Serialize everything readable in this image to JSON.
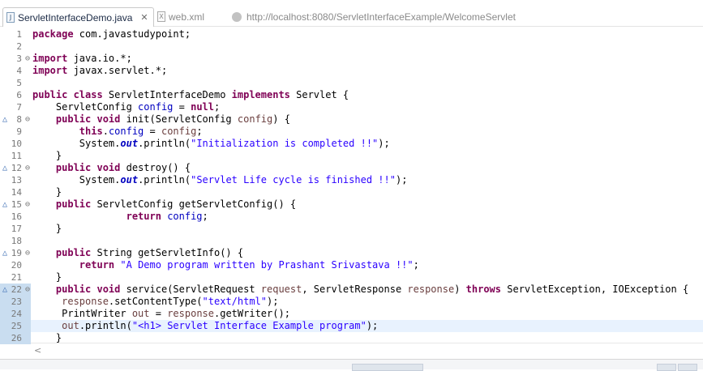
{
  "tabs": [
    {
      "label": "ServletInterfaceDemo.java",
      "icon": "java-file-icon",
      "close": "✕"
    },
    {
      "label": "web.xml",
      "icon": "xml-file-icon"
    },
    {
      "label": "http://localhost:8080/ServletInterfaceExample/WelcomeServlet",
      "icon": "globe-icon"
    }
  ],
  "colors": {
    "keyword": "#7f0055",
    "string": "#2a00ff",
    "field": "#0000c0",
    "parameter": "#6a3e3e",
    "current_line": "#e8f2fe",
    "line_number": "#787878"
  },
  "editor": {
    "current_line": 25,
    "lines": [
      {
        "n": "1",
        "tokens": [
          {
            "t": "kw",
            "v": "package"
          },
          {
            "t": "p",
            "v": " com.javastudypoint;"
          }
        ]
      },
      {
        "n": "2",
        "tokens": []
      },
      {
        "n": "3",
        "fold": "⊖",
        "tokens": [
          {
            "t": "kw",
            "v": "import"
          },
          {
            "t": "p",
            "v": " java.io.*;"
          }
        ]
      },
      {
        "n": "4",
        "tokens": [
          {
            "t": "kw",
            "v": "import"
          },
          {
            "t": "p",
            "v": " javax.servlet.*;"
          }
        ]
      },
      {
        "n": "5",
        "tokens": []
      },
      {
        "n": "6",
        "tokens": [
          {
            "t": "kw",
            "v": "public class"
          },
          {
            "t": "p",
            "v": " ServletInterfaceDemo "
          },
          {
            "t": "kw",
            "v": "implements"
          },
          {
            "t": "p",
            "v": " Servlet {"
          }
        ]
      },
      {
        "n": "7",
        "tokens": [
          {
            "t": "p",
            "v": "    ServletConfig "
          },
          {
            "t": "fld",
            "v": "config"
          },
          {
            "t": "p",
            "v": " = "
          },
          {
            "t": "kw",
            "v": "null"
          },
          {
            "t": "p",
            "v": ";"
          }
        ]
      },
      {
        "n": "8",
        "fold": "⊖",
        "override": "△",
        "tokens": [
          {
            "t": "p",
            "v": "    "
          },
          {
            "t": "kw",
            "v": "public void"
          },
          {
            "t": "p",
            "v": " init(ServletConfig "
          },
          {
            "t": "prm",
            "v": "config"
          },
          {
            "t": "p",
            "v": ") {"
          }
        ]
      },
      {
        "n": "9",
        "tokens": [
          {
            "t": "p",
            "v": "        "
          },
          {
            "t": "kw",
            "v": "this"
          },
          {
            "t": "p",
            "v": "."
          },
          {
            "t": "fld",
            "v": "config"
          },
          {
            "t": "p",
            "v": " = "
          },
          {
            "t": "prm",
            "v": "config"
          },
          {
            "t": "p",
            "v": ";"
          }
        ]
      },
      {
        "n": "10",
        "tokens": [
          {
            "t": "p",
            "v": "        System."
          },
          {
            "t": "sfld",
            "v": "out"
          },
          {
            "t": "p",
            "v": ".println("
          },
          {
            "t": "str",
            "v": "\"Initialization is completed !!\""
          },
          {
            "t": "p",
            "v": ");"
          }
        ]
      },
      {
        "n": "11",
        "tokens": [
          {
            "t": "p",
            "v": "    }"
          }
        ]
      },
      {
        "n": "12",
        "fold": "⊖",
        "override": "△",
        "tokens": [
          {
            "t": "p",
            "v": "    "
          },
          {
            "t": "kw",
            "v": "public void"
          },
          {
            "t": "p",
            "v": " destroy() {"
          }
        ]
      },
      {
        "n": "13",
        "tokens": [
          {
            "t": "p",
            "v": "        System."
          },
          {
            "t": "sfld",
            "v": "out"
          },
          {
            "t": "p",
            "v": ".println("
          },
          {
            "t": "str",
            "v": "\"Servlet Life cycle is finished !!\""
          },
          {
            "t": "p",
            "v": ");"
          }
        ]
      },
      {
        "n": "14",
        "tokens": [
          {
            "t": "p",
            "v": "    }"
          }
        ]
      },
      {
        "n": "15",
        "fold": "⊖",
        "override": "△",
        "tokens": [
          {
            "t": "p",
            "v": "    "
          },
          {
            "t": "kw",
            "v": "public"
          },
          {
            "t": "p",
            "v": " ServletConfig getServletConfig() {"
          }
        ]
      },
      {
        "n": "16",
        "tokens": [
          {
            "t": "p",
            "v": "                "
          },
          {
            "t": "kw",
            "v": "return"
          },
          {
            "t": "p",
            "v": " "
          },
          {
            "t": "fld",
            "v": "config"
          },
          {
            "t": "p",
            "v": ";"
          }
        ]
      },
      {
        "n": "17",
        "tokens": [
          {
            "t": "p",
            "v": "    }"
          }
        ]
      },
      {
        "n": "18",
        "tokens": []
      },
      {
        "n": "19",
        "fold": "⊖",
        "override": "△",
        "tokens": [
          {
            "t": "p",
            "v": "    "
          },
          {
            "t": "kw",
            "v": "public"
          },
          {
            "t": "p",
            "v": " String getServletInfo() {"
          }
        ]
      },
      {
        "n": "20",
        "tokens": [
          {
            "t": "p",
            "v": "        "
          },
          {
            "t": "kw",
            "v": "return"
          },
          {
            "t": "p",
            "v": " "
          },
          {
            "t": "str",
            "v": "\"A Demo program written by Prashant Srivastava !!\""
          },
          {
            "t": "p",
            "v": ";"
          }
        ]
      },
      {
        "n": "21",
        "tokens": [
          {
            "t": "p",
            "v": "    }"
          }
        ]
      },
      {
        "n": "22",
        "fold": "⊖",
        "override": "△",
        "stripe": true,
        "tokens": [
          {
            "t": "p",
            "v": "    "
          },
          {
            "t": "kw",
            "v": "public void"
          },
          {
            "t": "p",
            "v": " service(ServletRequest "
          },
          {
            "t": "prm",
            "v": "request"
          },
          {
            "t": "p",
            "v": ", ServletResponse "
          },
          {
            "t": "prm",
            "v": "response"
          },
          {
            "t": "p",
            "v": ") "
          },
          {
            "t": "kw",
            "v": "throws"
          },
          {
            "t": "p",
            "v": " ServletException, IOException {"
          }
        ]
      },
      {
        "n": "23",
        "stripe": true,
        "tokens": [
          {
            "t": "p",
            "v": "     "
          },
          {
            "t": "prm",
            "v": "response"
          },
          {
            "t": "p",
            "v": ".setContentType("
          },
          {
            "t": "str",
            "v": "\"text/html\""
          },
          {
            "t": "p",
            "v": ");"
          }
        ]
      },
      {
        "n": "24",
        "stripe": true,
        "tokens": [
          {
            "t": "p",
            "v": "     PrintWriter "
          },
          {
            "t": "prm",
            "v": "out"
          },
          {
            "t": "p",
            "v": " = "
          },
          {
            "t": "prm",
            "v": "response"
          },
          {
            "t": "p",
            "v": ".getWriter();"
          }
        ]
      },
      {
        "n": "25",
        "stripe": true,
        "tokens": [
          {
            "t": "p",
            "v": "     "
          },
          {
            "t": "prm",
            "v": "out"
          },
          {
            "t": "p",
            "v": ".println("
          },
          {
            "t": "str",
            "v": "\"<h1> Servlet Interface Example program\""
          },
          {
            "t": "p",
            "v": ");"
          }
        ]
      },
      {
        "n": "26",
        "stripe": true,
        "tokens": [
          {
            "t": "p",
            "v": "    }"
          }
        ]
      }
    ]
  },
  "scrollbar": {
    "left_arrow": "<"
  }
}
